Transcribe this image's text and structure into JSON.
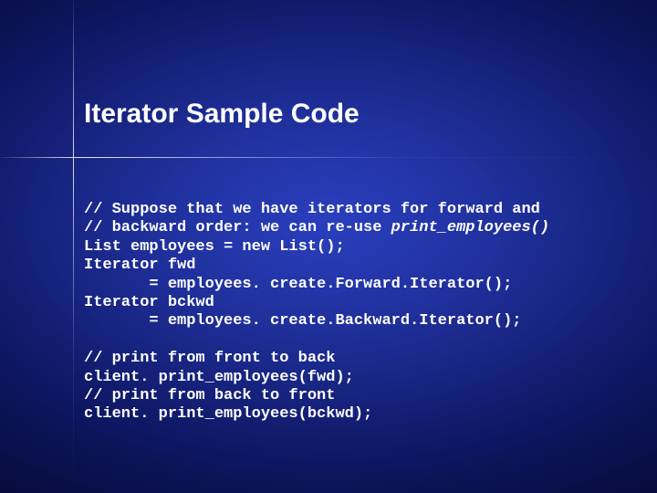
{
  "title": "Iterator Sample Code",
  "code": {
    "l1a": "// Suppose that we have iterators for forward and",
    "l2a": "// backward order: we can re-use ",
    "l2b": "print_employees()",
    "l3": "List employees = new List();",
    "l4": "Iterator fwd",
    "l5": "       = employees. create.Forward.Iterator();",
    "l6": "Iterator bckwd",
    "l7": "       = employees. create.Backward.Iterator();",
    "blank": " ",
    "l8": "// print from front to back",
    "l9": "client. print_employees(fwd);",
    "l10": "// print from back to front",
    "l11": "client. print_employees(bckwd);"
  }
}
